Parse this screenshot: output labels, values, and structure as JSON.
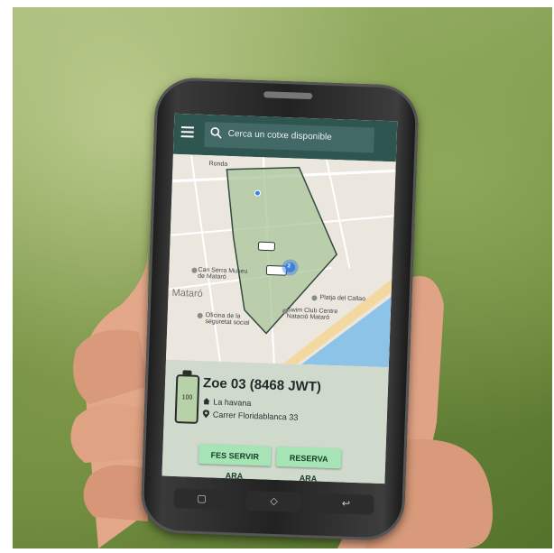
{
  "app": {
    "search_placeholder": "Cerca un cotxe disponible"
  },
  "map": {
    "labels": {
      "road": "Ronda",
      "museum": "Can Serra Museu de Mataró",
      "town": "Mataró",
      "beach": "Platja del Callao",
      "club": "Swim Club Centre Natació Mataró",
      "office": "Oficina de la seguretat social",
      "cluster_count": "2"
    }
  },
  "vehicle": {
    "name": "Zoe 03 (8468 JWT)",
    "battery": "100",
    "location": "La havana",
    "address": "Carrer Floridablanca 33"
  },
  "actions": {
    "use_now": "FES SERVIR ARA",
    "reserve": "RESERVA ARA"
  },
  "colors": {
    "topbar": "#2f5550",
    "accent_button": "#a6e4b5",
    "zone_fill": "#a9c59b",
    "sea": "#8ec3e8"
  }
}
